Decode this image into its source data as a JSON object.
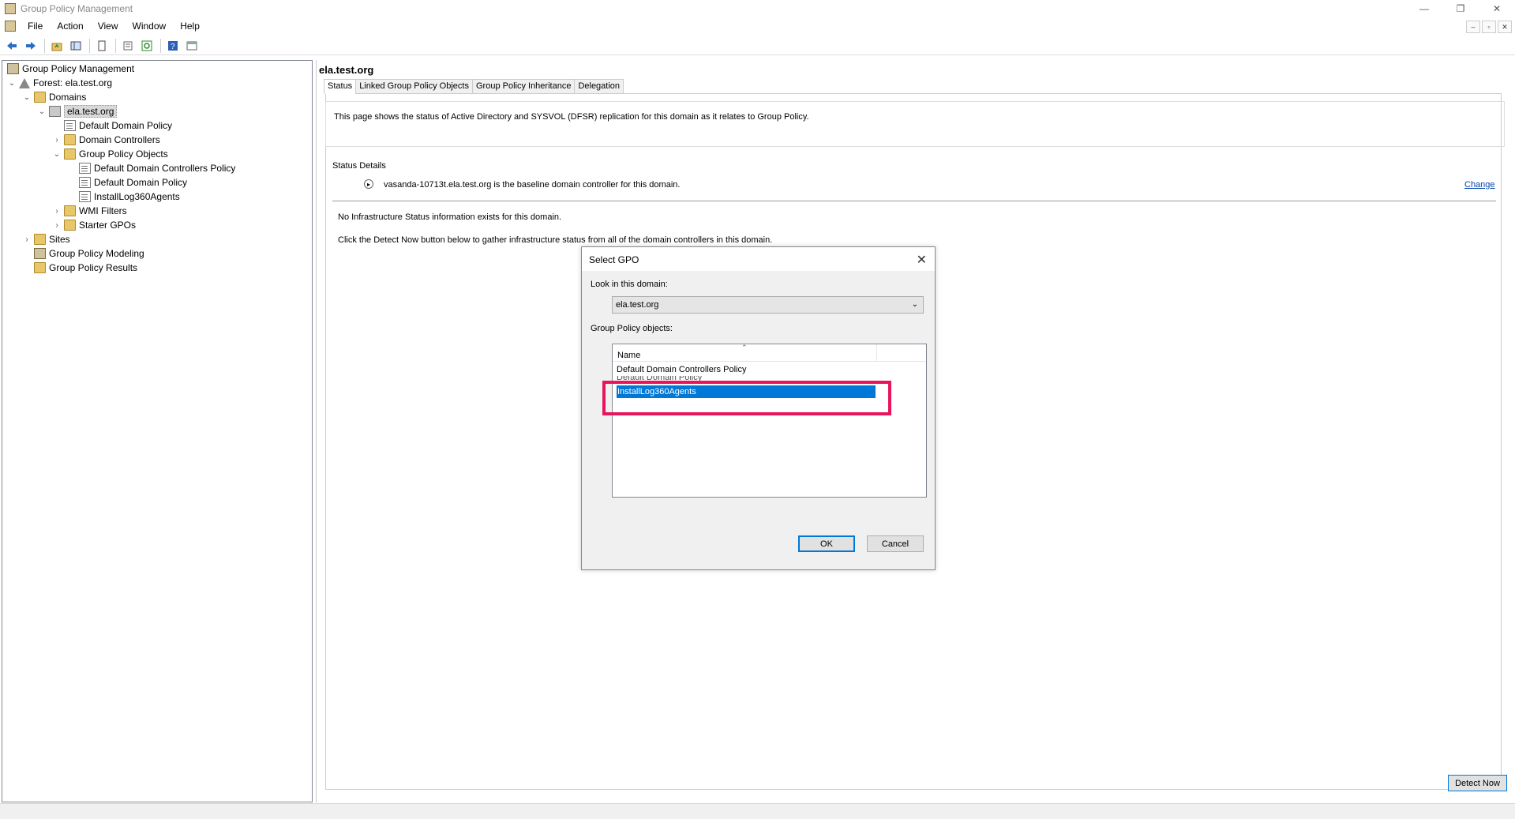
{
  "window": {
    "title": "Group Policy Management",
    "controls": [
      "—",
      "❐",
      "✕"
    ]
  },
  "menu": [
    "File",
    "Action",
    "View",
    "Window",
    "Help"
  ],
  "mdi_controls": [
    "–",
    "▫",
    "✕"
  ],
  "toolbar": {
    "buttons": [
      "back-icon",
      "forward-icon",
      "up-folder-icon",
      "show-hide-tree-icon",
      "properties-icon",
      "export-icon",
      "refresh-icon",
      "help-icon",
      "console-icon"
    ]
  },
  "tree": {
    "root": "Group Policy Management",
    "forest": "Forest: ela.test.org",
    "domains": "Domains",
    "domain": "ela.test.org",
    "default_domain_policy": "Default Domain Policy",
    "domain_controllers": "Domain Controllers",
    "gpo_folder": "Group Policy Objects",
    "gpos": [
      "Default Domain Controllers Policy",
      "Default Domain Policy",
      "InstallLog360Agents"
    ],
    "wmi_filters": "WMI Filters",
    "starter_gpos": "Starter GPOs",
    "sites": "Sites",
    "modeling": "Group Policy Modeling",
    "results": "Group Policy Results"
  },
  "main": {
    "title": "ela.test.org",
    "tabs": [
      "Status",
      "Linked Group Policy Objects",
      "Group Policy Inheritance",
      "Delegation"
    ],
    "active_tab": "Status",
    "info_text": "This page shows the status of Active Directory and SYSVOL (DFSR) replication for this domain as it relates to Group Policy.",
    "status_details_title": "Status Details",
    "baseline_text": "vasanda-10713t.ela.test.org is the baseline domain controller for this domain.",
    "change_link": "Change",
    "no_info_text": "No Infrastructure Status information exists for this domain.",
    "click_text": "Click the Detect Now button below to gather infrastructure status from all of the domain controllers in this domain.",
    "detect_button": "Detect Now"
  },
  "dialog": {
    "title": "Select GPO",
    "look_in_label": "Look in this domain:",
    "domain_value": "ela.test.org",
    "objects_label": "Group Policy objects:",
    "column_name": "Name",
    "items": [
      "Default Domain Controllers Policy",
      "Default Domain Policy",
      "InstallLog360Agents"
    ],
    "selected": "InstallLog360Agents",
    "ok_label": "OK",
    "cancel_label": "Cancel",
    "highlight_color": "#e8155c",
    "selection_color": "#0078d7"
  }
}
